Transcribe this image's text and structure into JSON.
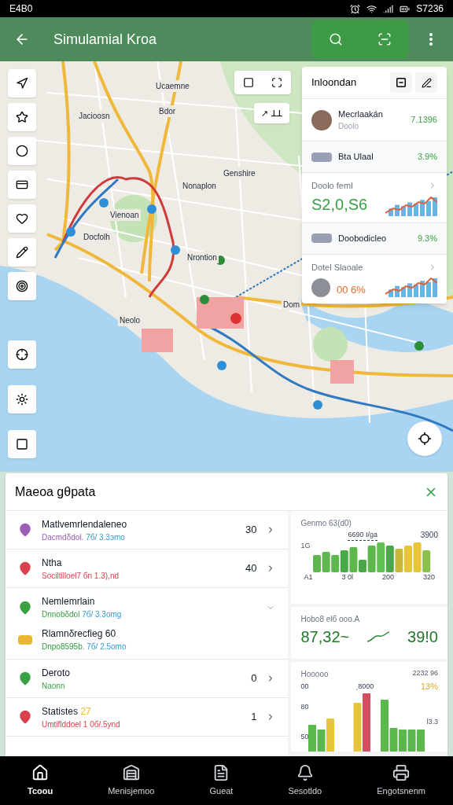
{
  "status_bar": {
    "time": "E4B0",
    "right": "S7236"
  },
  "app_bar": {
    "title": "Simulamial Kroa"
  },
  "map": {
    "labels": [
      "Jacioosn",
      "Ucaemne",
      "Bdor",
      "Genshire",
      "Nonaplon",
      "Vienoan",
      "Docfolh",
      "Nrontion",
      "Neolo",
      "Dom"
    ],
    "scale_label": "↗ ꓕꓕ"
  },
  "insights": {
    "title": "Inloondan",
    "rows": [
      {
        "kind": "avatar",
        "title": "Mecrlaakán",
        "subtitle": "Doolo",
        "value": "7.1396",
        "color": "#3aa043"
      },
      {
        "kind": "thumb",
        "title": "Bta Ulaal",
        "value": "3.9%",
        "color": "#3aa043"
      },
      {
        "kind": "chart",
        "title": "Doolo feml",
        "value": "S2,0,S6",
        "color": "#3aa043"
      },
      {
        "kind": "thumb",
        "title": "Doobodicleo",
        "value": "9.3%",
        "color": "#3aa043"
      },
      {
        "kind": "chart",
        "title": "Dotel Slaoale",
        "value": "00 6%",
        "color": "#e56a2c"
      }
    ]
  },
  "panel": {
    "title": "Maeoa gθpata",
    "items": [
      {
        "kind": "row",
        "color": "#9c5fb5",
        "title": "Matlvemrlendaleneo",
        "subtitle": "Dacmdδdol.",
        "detail": "7б/ 3.3эmo",
        "count": "30",
        "expanded": false
      },
      {
        "kind": "row",
        "color": "#d9414e",
        "title": "Ntha",
        "subtitle": "Sociltilloel7 бn 1.3),nd",
        "count": "40",
        "expanded": false
      },
      {
        "kind": "group",
        "color": "#3aa043",
        "title": "Nemlemrlain",
        "subtitle": "Dnnobδdol",
        "detail": "7б/ 3.3omg",
        "expanded": true,
        "children": [
          {
            "color": "#e8b630",
            "title": "Rlamnδrecfieg 60",
            "subtitle": "Dnpo8595b.",
            "detail": "7б/ 2.5omo"
          }
        ]
      },
      {
        "kind": "row",
        "color": "#3aa043",
        "title": "Deroto",
        "subtitle": "Naonn",
        "count": "0",
        "expanded": false
      },
      {
        "kind": "row",
        "color": "#d9414e",
        "title": "Statistes",
        "badge": "27",
        "subtitle": "Umtiflddoel 1 0б/.5ynd",
        "count": "1",
        "expanded": false
      }
    ],
    "stats": [
      {
        "kind": "bars",
        "title": "Genmo 63(d0)",
        "note": "6690 I/ga",
        "peak": "3900",
        "y_label": "1G",
        "x_labels": [
          "A1",
          "3 0l",
          "200",
          "320"
        ]
      },
      {
        "kind": "numbers",
        "title": "Hobo8 elб ooo.A",
        "left": "87,32~",
        "right": "39!0"
      },
      {
        "kind": "mixed",
        "title": "Hooooo",
        "corner": "2232 96",
        "pct": "13%",
        "note": "ˏ8000",
        "side": "Ɩ3.3",
        "y_labels": [
          "00",
          "80",
          "50"
        ]
      }
    ]
  },
  "nav": [
    {
      "label": "Tcoou",
      "selected": true
    },
    {
      "label": "Menisjemoo",
      "selected": false
    },
    {
      "label": "Gueat",
      "selected": false
    },
    {
      "label": "Sesotldo",
      "selected": false
    },
    {
      "label": "Engotsnenm",
      "selected": false
    }
  ]
}
